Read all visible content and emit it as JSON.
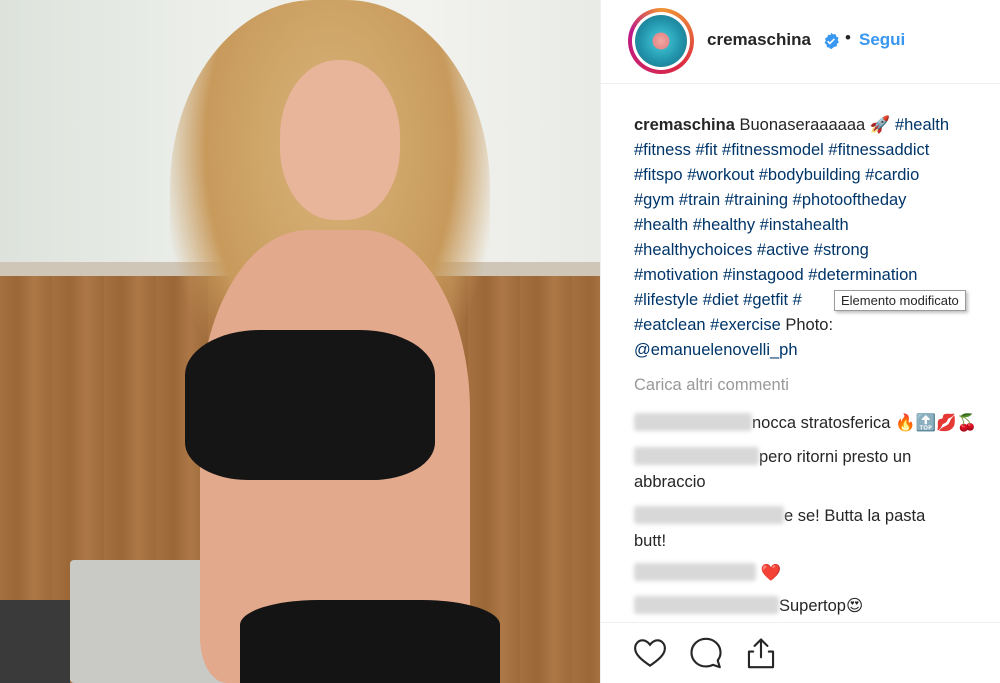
{
  "post": {
    "username": "cremaschina",
    "follow_label": "Segui",
    "separator": "•",
    "verified_icon": "verified-badge-icon"
  },
  "caption": {
    "username": "cremaschina",
    "text_lead": "Buonaseraaaaaa",
    "emoji": "🚀",
    "lines": [
      "#health",
      "#fitness #fit #fitnessmodel #fitnessaddict",
      "#fitspo #workout #bodybuilding #cardio",
      "#gym #train #training #photooftheday",
      "#health #healthy #instahealth",
      "#healthychoices #active #strong",
      "#motivation #instagood #determination",
      "#lifestyle #diet #getfit #",
      "#eatclean #exercise"
    ],
    "photo_credit_label": "Photo:",
    "mention": "@emanuelenovelli_ph"
  },
  "tooltip": "Elemento modificato",
  "load_more": "Carica altri commenti",
  "comments": [
    {
      "text": "nocca stratosferica",
      "emojis": "🔥🔝💋🍒"
    },
    {
      "text": "pero ritorni presto un",
      "text2": "abbraccio"
    },
    {
      "text": "e se! Butta la pasta",
      "text2": "butt!"
    },
    {
      "text": "",
      "emojis": "❤️"
    },
    {
      "text": "Supertop",
      "emojis": "😍"
    }
  ],
  "actions": [
    "heart-icon",
    "comment-icon",
    "share-icon"
  ],
  "colors": {
    "link": "#003569",
    "follow": "#3897f0",
    "muted": "#999999"
  }
}
